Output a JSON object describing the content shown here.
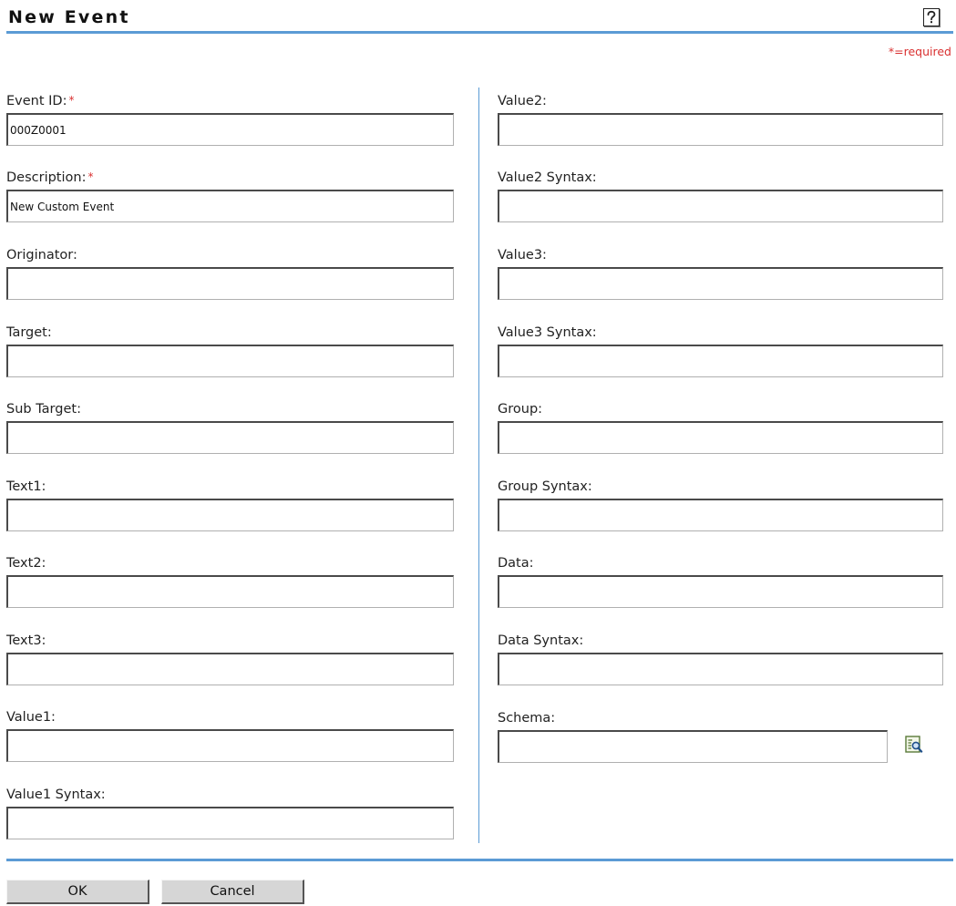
{
  "header": {
    "title": "New Event",
    "help_icon": "question-mark-icon",
    "required_note": "*=required"
  },
  "left_column": {
    "fields": [
      {
        "label": "Event ID:",
        "required": "*",
        "value": "000Z0001",
        "placeholder": ""
      },
      {
        "label": "Description:",
        "required": "*",
        "value": "New Custom Event",
        "placeholder": ""
      },
      {
        "label": "Originator:",
        "value": "",
        "placeholder": ""
      },
      {
        "label": "Target:",
        "value": "",
        "placeholder": ""
      },
      {
        "label": "Sub Target:",
        "value": "",
        "placeholder": ""
      },
      {
        "label": "Text1:",
        "value": "",
        "placeholder": ""
      },
      {
        "label": "Text2:",
        "value": "",
        "placeholder": ""
      },
      {
        "label": "Text3:",
        "value": "",
        "placeholder": ""
      },
      {
        "label": "Value1:",
        "value": "",
        "placeholder": ""
      },
      {
        "label": "Value1 Syntax:",
        "value": "",
        "placeholder": ""
      }
    ]
  },
  "right_column": {
    "fields": [
      {
        "label": "Value2:",
        "value": "",
        "placeholder": ""
      },
      {
        "label": "Value2 Syntax:",
        "value": "",
        "placeholder": ""
      },
      {
        "label": "Value3:",
        "value": "",
        "placeholder": ""
      },
      {
        "label": "Value3 Syntax:",
        "value": "",
        "placeholder": ""
      },
      {
        "label": "Group:",
        "value": "",
        "placeholder": ""
      },
      {
        "label": "Group Syntax:",
        "value": "",
        "placeholder": ""
      },
      {
        "label": "Data:",
        "value": "",
        "placeholder": ""
      },
      {
        "label": "Data Syntax:",
        "value": "",
        "placeholder": ""
      },
      {
        "label": "Schema:",
        "value": "",
        "placeholder": "",
        "browse_icon": "object-selector-icon"
      }
    ]
  },
  "buttons": {
    "ok_label": "OK",
    "cancel_label": "Cancel"
  },
  "colors": {
    "accent_rule": "#5b9bd5",
    "required": "#d93030",
    "button_face": "#d6d6d6"
  }
}
